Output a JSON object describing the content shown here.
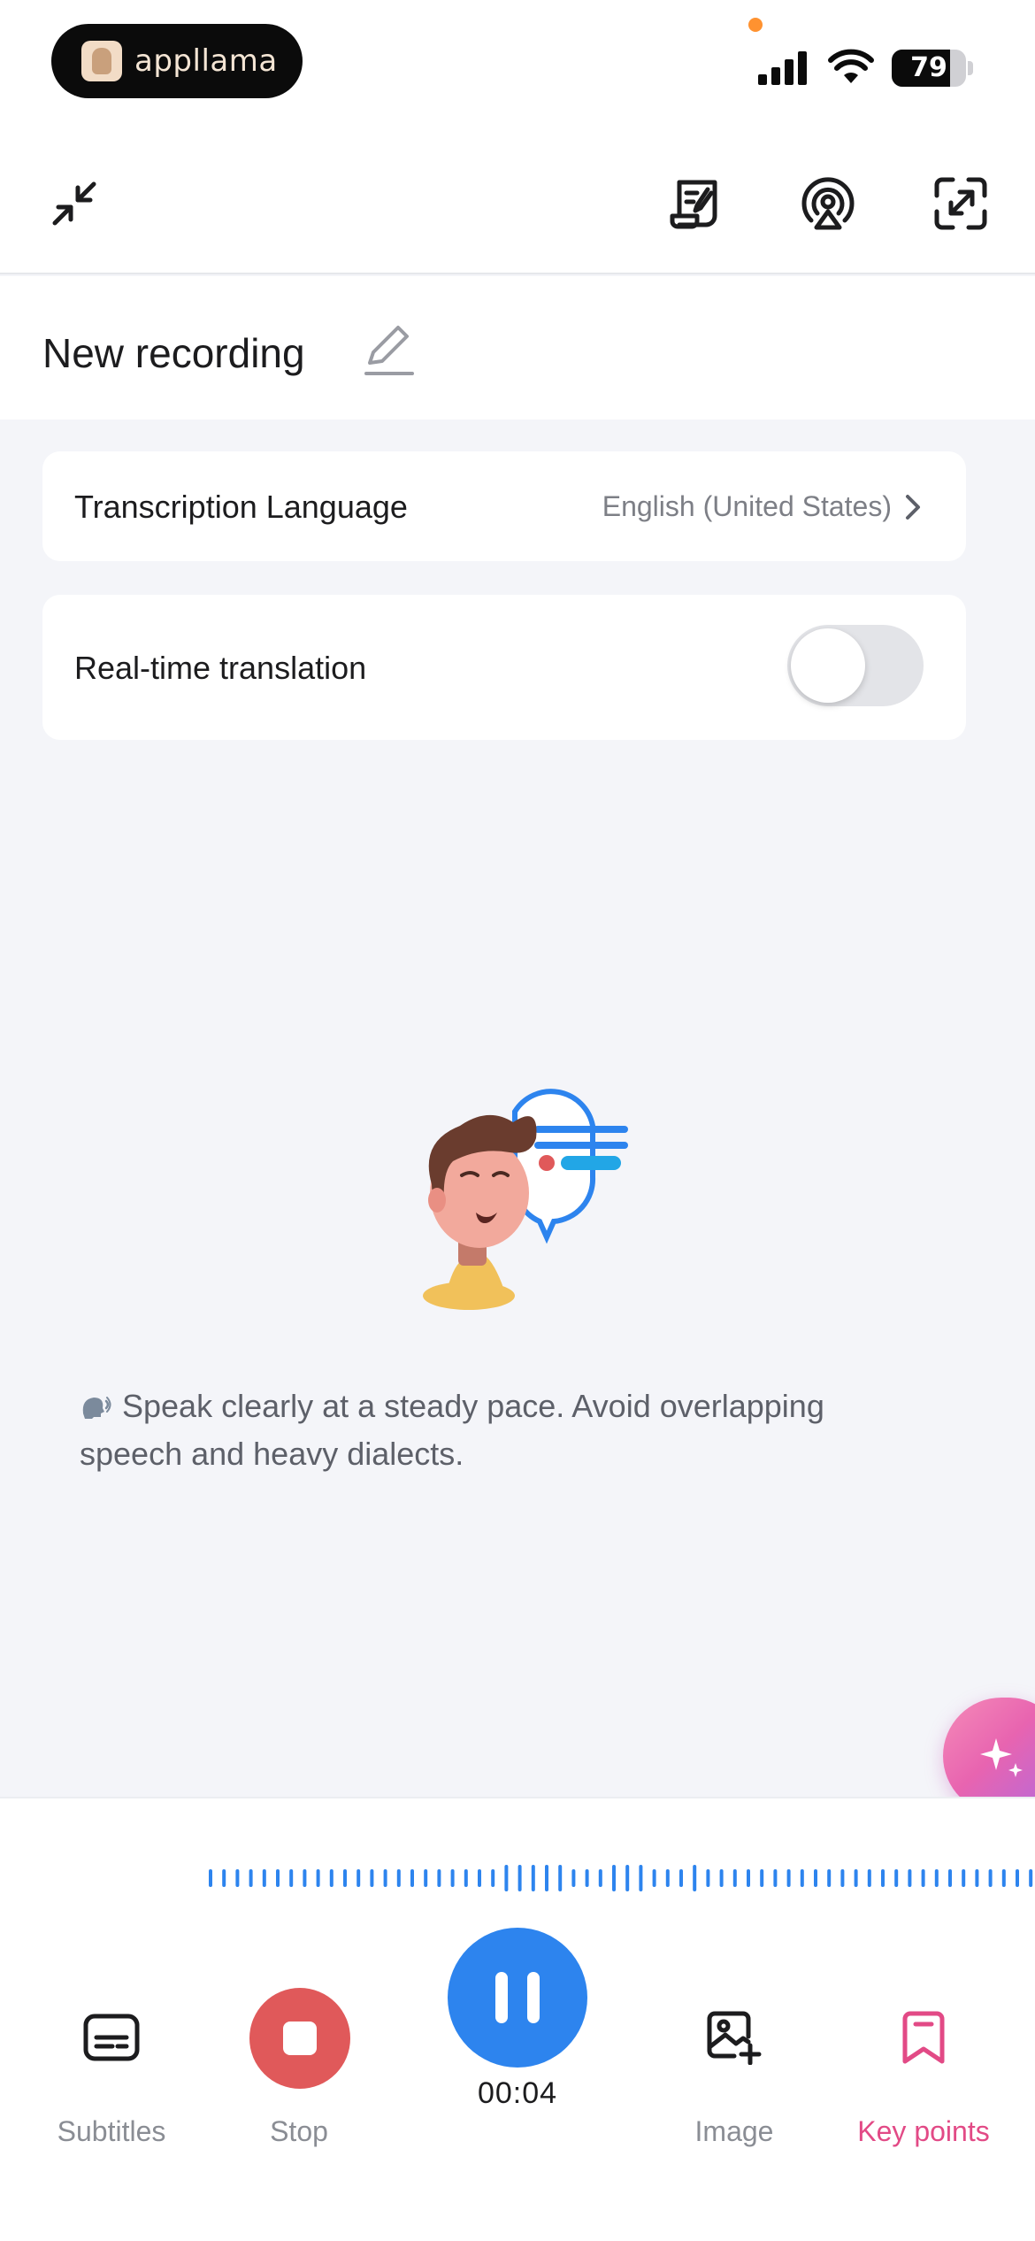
{
  "status_bar": {
    "app_pill_name": "appllama",
    "battery_level": 79,
    "battery_text": "79",
    "icons": [
      "signal-icon",
      "wifi-icon",
      "battery-icon"
    ]
  },
  "toolbar": {
    "left": [
      "collapse-icon"
    ],
    "right": [
      "notes-scroll-icon",
      "live-broadcast-icon",
      "expand-icon"
    ]
  },
  "recording": {
    "title": "New recording"
  },
  "settings": {
    "transcription_label": "Transcription Language",
    "transcription_value": "English (United States)",
    "translation_label": "Real-time translation",
    "translation_enabled": false
  },
  "tip": {
    "text": "Speak clearly at a steady pace. Avoid overlapping speech and heavy dialects."
  },
  "controls": {
    "subtitles_label": "Subtitles",
    "stop_label": "Stop",
    "timer": "00:04",
    "image_label": "Image",
    "keypoints_label": "Key points"
  },
  "colors": {
    "accent_blue": "#2d84ee",
    "stop_red": "#e0595a",
    "key_points_pink": "#e24a86",
    "waveform_blue": "#2d84ee",
    "background": "#f4f5f9"
  }
}
